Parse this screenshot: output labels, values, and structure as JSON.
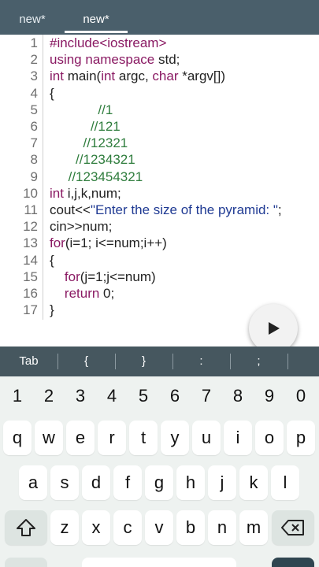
{
  "tabs": [
    {
      "label": "new*"
    },
    {
      "label": "new*"
    }
  ],
  "editor": {
    "lines": [
      {
        "n": "1",
        "parts": [
          {
            "t": "#include<iostream>",
            "c": "kw"
          }
        ]
      },
      {
        "n": "2",
        "parts": [
          {
            "t": "using namespace ",
            "c": "kw"
          },
          {
            "t": "std;",
            "c": ""
          }
        ]
      },
      {
        "n": "3",
        "parts": [
          {
            "t": "int ",
            "c": "kw"
          },
          {
            "t": "main(",
            "c": ""
          },
          {
            "t": "int ",
            "c": "kw"
          },
          {
            "t": "argc, ",
            "c": ""
          },
          {
            "t": "char ",
            "c": "kw"
          },
          {
            "t": "*argv[])",
            "c": ""
          }
        ]
      },
      {
        "n": "4",
        "parts": [
          {
            "t": "{",
            "c": ""
          }
        ]
      },
      {
        "n": "5",
        "parts": [
          {
            "t": "             //1",
            "c": "cm"
          }
        ]
      },
      {
        "n": "6",
        "parts": [
          {
            "t": "           //121",
            "c": "cm"
          }
        ]
      },
      {
        "n": "7",
        "parts": [
          {
            "t": "         //12321",
            "c": "cm"
          }
        ]
      },
      {
        "n": "8",
        "parts": [
          {
            "t": "       //1234321",
            "c": "cm"
          }
        ]
      },
      {
        "n": "9",
        "parts": [
          {
            "t": "     //123454321",
            "c": "cm"
          }
        ]
      },
      {
        "n": "10",
        "parts": [
          {
            "t": "int ",
            "c": "kw"
          },
          {
            "t": "i,j,k,num;",
            "c": ""
          }
        ]
      },
      {
        "n": "11",
        "parts": [
          {
            "t": "cout<<",
            "c": ""
          },
          {
            "t": "\"Enter the size of the pyramid: \"",
            "c": "st"
          },
          {
            "t": ";",
            "c": ""
          }
        ]
      },
      {
        "n": "12",
        "parts": [
          {
            "t": "cin>>num;",
            "c": ""
          }
        ]
      },
      {
        "n": "13",
        "parts": [
          {
            "t": "for",
            "c": "kw"
          },
          {
            "t": "(i=1; i<=num;i++)",
            "c": ""
          }
        ]
      },
      {
        "n": "14",
        "parts": [
          {
            "t": "{",
            "c": ""
          }
        ]
      },
      {
        "n": "15",
        "parts": [
          {
            "t": "    ",
            "c": ""
          },
          {
            "t": "for",
            "c": "kw"
          },
          {
            "t": "(j=1;j<=num)",
            "c": ""
          }
        ]
      },
      {
        "n": "16",
        "parts": [
          {
            "t": "    ",
            "c": ""
          },
          {
            "t": "return ",
            "c": "kw"
          },
          {
            "t": "0;",
            "c": ""
          }
        ]
      },
      {
        "n": "17",
        "parts": [
          {
            "t": "}",
            "c": ""
          }
        ]
      }
    ]
  },
  "run_button_icon": "play-icon",
  "symbol_bar": [
    "Tab",
    "{",
    "}",
    ":",
    ";"
  ],
  "keyboard": {
    "numbers": [
      "1",
      "2",
      "3",
      "4",
      "5",
      "6",
      "7",
      "8",
      "9",
      "0"
    ],
    "row1": [
      "q",
      "w",
      "e",
      "r",
      "t",
      "y",
      "u",
      "i",
      "o",
      "p"
    ],
    "row2": [
      "a",
      "s",
      "d",
      "f",
      "g",
      "h",
      "j",
      "k",
      "l"
    ],
    "row3": [
      "z",
      "x",
      "c",
      "v",
      "b",
      "n",
      "m"
    ],
    "shift_icon": "shift-icon",
    "backspace_icon": "backspace-icon"
  },
  "colors": {
    "tabbar": "#4a5f6b",
    "symbar": "#46575f",
    "keyword": "#8a1a63",
    "comment": "#2f7d3d",
    "string": "#1f3a93"
  }
}
